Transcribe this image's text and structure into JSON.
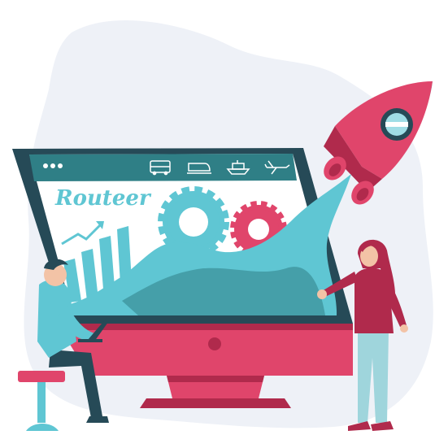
{
  "brand": {
    "name": "Routeer"
  },
  "browser": {
    "window_dots": 3,
    "nav_icons": [
      "bus-icon",
      "train-icon",
      "ship-icon",
      "airplane-icon"
    ]
  },
  "colors": {
    "pink": "#e0456b",
    "dark_pink": "#b02a4c",
    "teal": "#5fc6d3",
    "dark_teal": "#2f7f86",
    "navy": "#264a57",
    "blob": "#eef1f7",
    "skin": "#f3c3a6"
  }
}
